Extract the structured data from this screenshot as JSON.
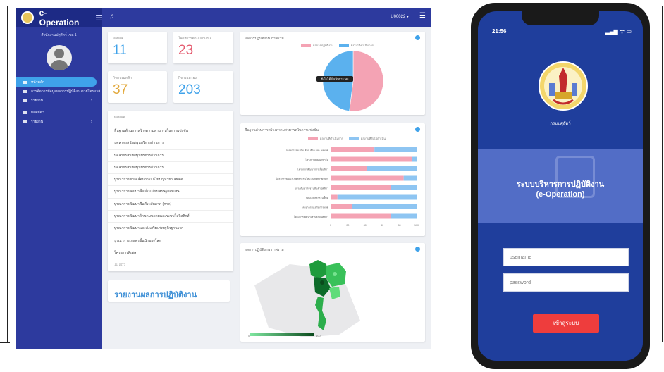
{
  "app": {
    "title": "e-Operation",
    "org_line": "สำนักงานปศุสัตว์ เขต 1",
    "user": "U00022"
  },
  "sidebar": {
    "items": [
      {
        "label": "หน้าหลัก"
      },
      {
        "label": "การจัดการข้อมูลผลการปฏิบัติงานรายไตรมาส"
      },
      {
        "label": "รายงาน"
      },
      {
        "label": "ผลิตชีตัว"
      },
      {
        "label": "รายงาน"
      }
    ]
  },
  "stats": [
    {
      "label": "ผลผลิต",
      "value": "11",
      "color": "#3fa2ea"
    },
    {
      "label": "โครงการตามแผนเงิน",
      "value": "23",
      "color": "#e45a6e"
    },
    {
      "label": "กิจกรรมหลัก",
      "value": "37",
      "color": "#e2a83b"
    },
    {
      "label": "กิจกรรมรอง",
      "value": "203",
      "color": "#3fa2ea"
    }
  ],
  "project_list": {
    "header": "ผลผลิต",
    "rows": [
      "พื้นฐานด้านการสร้างความสามารถในการแข่งขัน",
      "บุคลากรสนับสนุนบริการด้านการ",
      "บุคลากรสนับสนุนบริการด้านการ",
      "บุคลากรสนับสนุนบริการด้านการ",
      "บูรณาการขับเคลื่อนการแก้ไขปัญหายาเสพติด",
      "บูรณาการพัฒนาพื้นที่ระเบียงเศรษฐกิจพิเศษ",
      "บูรณาการพัฒนาพื้นที่ระดับภาค (ภาค)",
      "บูรณาการพัฒนาด้านคมนาคมและระบบโลจิสติกส์",
      "บูรณาการพัฒนาและส่งเสริมเศรษฐกิจฐานราก",
      "บูรณาการเกษตรชั้นนำของโลก",
      "โครงการพิเศษ"
    ],
    "footer": "11 แถว"
  },
  "report_box": {
    "title": "รายงานผลการปฏิบัติงาน"
  },
  "pie_panel": {
    "title": "ผลการปฏิบัติงาน ภาพรวม",
    "legend": [
      "ผลการปฏิบัติงาน",
      "ยังไม่ได้ดำเนินการ"
    ],
    "tooltip": "ยังไม่ได้ดำเนินการ: 48"
  },
  "bar_panel": {
    "title": "พื้นฐานด้านการสร้างความสามารถในการแข่งขัน",
    "legend": [
      "ผลงานที่ดำเนินการ",
      "ผลงานที่ยังไม่ดำเนิน"
    ]
  },
  "map_panel": {
    "title": "ผลการปฏิบัติงาน ภาพรวม",
    "scale_min": "0",
    "scale_max": "100"
  },
  "phone": {
    "time": "21:56",
    "status": "▂▄▆ ᯤ ▭",
    "dept": "กรมปศุสัตว์",
    "system_title_line1": "ระบบบริหารการปฏิบัติงาน",
    "system_title_line2": "(e-Operation)",
    "username_placeholder": "username",
    "password_placeholder": "password",
    "login_label": "เข้าสู่ระบบ"
  },
  "colors": {
    "sidebar": "#2d3a9e",
    "accent": "#3fa2ea",
    "pink": "#f4a3b4",
    "blue": "#5bb1ee",
    "login": "#ee3d3d"
  },
  "chart_data": [
    {
      "type": "pie",
      "title": "ผลการปฏิบัติงาน ภาพรวม",
      "labels": [
        "ผลการปฏิบัติงาน",
        "ยังไม่ได้ดำเนินการ"
      ],
      "values": [
        52,
        48
      ],
      "colors": [
        "#f4a3b4",
        "#5bb1ee"
      ]
    },
    {
      "type": "bar",
      "orientation": "horizontal-stacked",
      "title": "พื้นฐานด้านการสร้างความสามารถในการแข่งขัน",
      "categories": [
        "โครงการส่งเสริม พันธุ์ สัตว์ และ ผลผลิต",
        "โครงการพัฒนาฟาร์ม",
        "โครงการพัฒนาการเลี้ยงสัตว์",
        "โครงการพัฒนาเกษตรกรรุ่นใหม่ (Smart Farmer)",
        "ยกระดับมาตรฐานสินค้าปศุสัตว์",
        "กลุ่มเกษตรกรในพื้นที่",
        "โครงการส่งเสริมการผลิต",
        "โครงการพัฒนาเศรษฐกิจปศุสัตว์"
      ],
      "series": [
        {
          "name": "ผลงานที่ดำเนินการ",
          "values": [
            51,
            95,
            42,
            85,
            70,
            8,
            25,
            70
          ]
        },
        {
          "name": "ผลงานที่ยังไม่ดำเนิน",
          "values": [
            49,
            5,
            58,
            15,
            30,
            92,
            75,
            30
          ]
        }
      ],
      "xlim": [
        0,
        100
      ],
      "xticks": [
        "0",
        "20",
        "40",
        "60",
        "80",
        "100"
      ],
      "colors": [
        "#f4a3b4",
        "#8ec5f2"
      ]
    }
  ]
}
